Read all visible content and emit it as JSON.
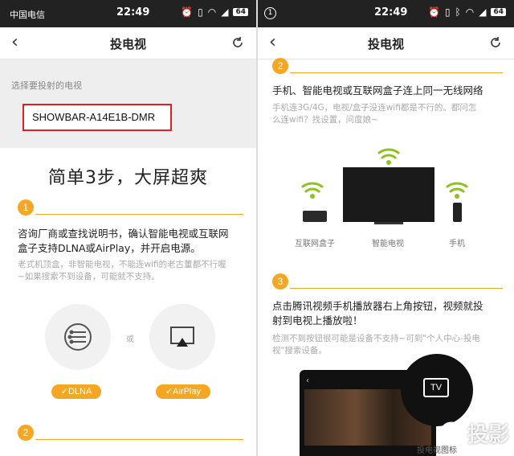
{
  "left": {
    "status": {
      "carrier": "中国电信",
      "time": "22:49",
      "battery": "64"
    },
    "header": {
      "title": "投电视"
    },
    "select_label": "选择要投射的电视",
    "device_name": "SHOWBAR-A14E1B-DMR",
    "headline": "简单3步，大屏超爽",
    "step1": {
      "number": "1",
      "title_line1": "咨询厂商或查找说明书，确认智能电视或互联网",
      "title_line2": "盒子支持DLNA或AirPlay，并开启电源。",
      "note_line1": "老式机顶盒，非智能电视，不能连wifi的老古董都不行喔",
      "note_line2": "~如果搜索不到设备，可能就不支持。"
    },
    "or_text": "或",
    "dlna_label": "✓DLNA",
    "airplay_label": "✓AirPlay",
    "step2_number": "2"
  },
  "right": {
    "status": {
      "time": "22:49",
      "battery": "64",
      "notif": "1"
    },
    "header": {
      "title": "投电视"
    },
    "step2": {
      "number": "2",
      "title": "手机、智能电视或互联网盒子连上同一无线网络",
      "note_line1": "手机连3G/4G，电视/盒子没连wifi都是不行的。都问怎",
      "note_line2": "么连wifi？找设置，问度娘~"
    },
    "captions": {
      "box": "互联网盒子",
      "tv": "智能电视",
      "phone": "手机"
    },
    "step3": {
      "number": "3",
      "title_line1": "点击腾讯视频手机播放器右上角按钮，视频就投",
      "title_line2": "射到电视上播放啦！",
      "note_line1": "检测不到按钮很可能是设备不支持~可到\"个人中心-投电",
      "note_line2": "视\"搜索设备。"
    },
    "tv_icon_label": "TV",
    "tv_icon_caption": "投电视图标",
    "watermark": "投影"
  },
  "colors": {
    "accent": "#f5a623",
    "highlight": "#e02020",
    "wifi": "#8dc21f"
  }
}
